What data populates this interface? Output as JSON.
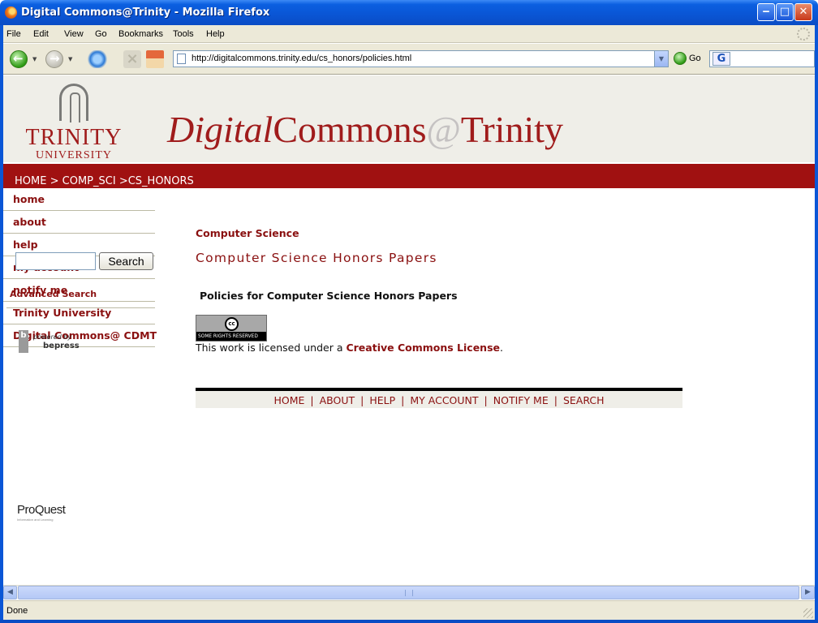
{
  "window": {
    "title": "Digital Commons@Trinity - Mozilla Firefox",
    "minimize": "‒",
    "maximize": "□",
    "close": "✕"
  },
  "menu": [
    "File",
    "Edit",
    "View",
    "Go",
    "Bookmarks",
    "Tools",
    "Help"
  ],
  "toolbar": {
    "url": "http://digitalcommons.trinity.edu/cs_honors/policies.html",
    "go_label": "Go",
    "search_engine_glyph": "G"
  },
  "site": {
    "logo_name": "TRINITY",
    "logo_sub": "UNIVERSITY",
    "title_part1": "Digital",
    "title_part2": "Commons",
    "title_at": "@",
    "title_part3": "Trinity"
  },
  "breadcrumb": [
    "HOME",
    "COMP_SCI",
    "CS_HONORS"
  ],
  "breadcrumb_sep": ">",
  "sidebar": {
    "items": [
      "home",
      "about",
      "help",
      "my account",
      "notify me",
      "Trinity University",
      "Digital Commons@ CDMT"
    ],
    "search_button": "Search",
    "search_value": "",
    "advanced_search": "Advanced Search",
    "bepress_line1": "powered by",
    "bepress_line2": "bepress",
    "bepress_glyph": "b",
    "proquest": "ProQuest",
    "proquest_sub": "Information and Learning"
  },
  "main": {
    "dept": "Computer Science",
    "title": "Computer Science Honors Papers",
    "policies_heading": "Policies for Computer Science Honors Papers",
    "cc_badge_glyph": "cc",
    "cc_badge_text": "SOME RIGHTS RESERVED",
    "license_prefix": "This work is licensed under a ",
    "license_link": "Creative Commons License",
    "license_suffix": "."
  },
  "footer": [
    "HOME",
    "ABOUT",
    "HELP",
    "MY ACCOUNT",
    "NOTIFY ME",
    "SEARCH"
  ],
  "footer_sep": "|",
  "status": "Done",
  "colors": {
    "brand": "#a01111",
    "link": "#8a1010",
    "title_bar": "#0a56d6"
  },
  "icons": [
    "firefox-icon",
    "back-arrow-icon",
    "forward-arrow-icon",
    "reload-icon",
    "stop-icon",
    "home-icon",
    "page-icon",
    "go-icon",
    "google-icon",
    "throbber-icon"
  ]
}
